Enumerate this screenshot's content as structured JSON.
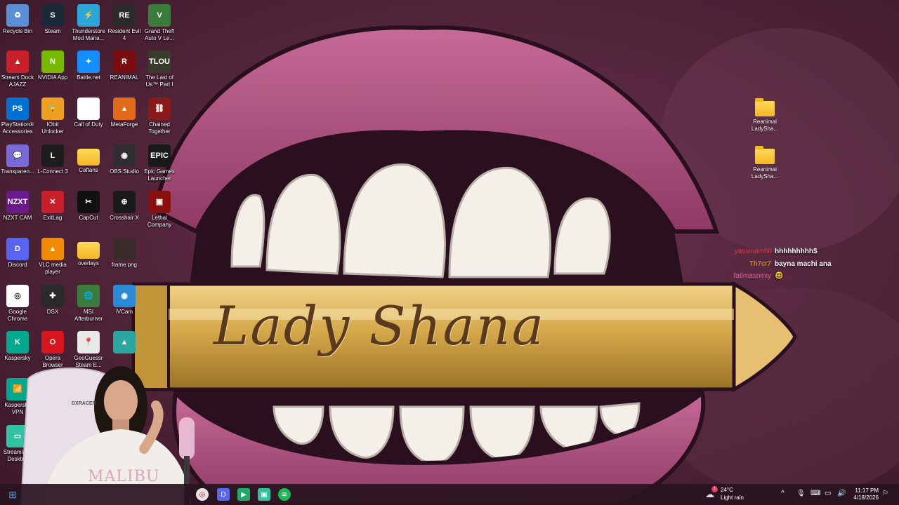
{
  "desktop_icons": [
    {
      "label": "Recycle Bin",
      "icon": "recycle-bin-icon",
      "color": "#5a8fd6",
      "glyph": "♻"
    },
    {
      "label": "Steam",
      "icon": "steam-icon",
      "color": "#1b2838",
      "glyph": "S"
    },
    {
      "label": "Thunderstore Mod Mana...",
      "icon": "thunderstore-icon",
      "color": "#2aa7d8",
      "glyph": "⚡"
    },
    {
      "label": "Resident Evil 4",
      "icon": "resident-evil-icon",
      "color": "#2b2b2b",
      "glyph": "RE"
    },
    {
      "label": "Grand Theft Auto V Le...",
      "icon": "gta-icon",
      "color": "#3a7d3a",
      "glyph": "V"
    },
    {
      "label": "Stream Dock AJAZZ",
      "icon": "stream-dock-icon",
      "color": "#c8202a",
      "glyph": "▲"
    },
    {
      "label": "NVIDIA App",
      "icon": "nvidia-icon",
      "color": "#76b900",
      "glyph": "N"
    },
    {
      "label": "Battle.net",
      "icon": "battlenet-icon",
      "color": "#148eff",
      "glyph": "✦"
    },
    {
      "label": "REANIMAL",
      "icon": "reanimal-icon",
      "color": "#7a0d10",
      "glyph": "R"
    },
    {
      "label": "The Last of Us™ Part I",
      "icon": "last-of-us-icon",
      "color": "#3b3b2b",
      "glyph": "TLOU"
    },
    {
      "label": "PlayStation® Accessories",
      "icon": "playstation-icon",
      "color": "#0070d1",
      "glyph": "PS"
    },
    {
      "label": "IObit Unlocker",
      "icon": "iobit-icon",
      "color": "#f0a020",
      "glyph": "🔒"
    },
    {
      "label": "Call of Duty",
      "icon": "call-of-duty-icon",
      "color": "#ffffff",
      "glyph": ""
    },
    {
      "label": "MetaForge",
      "icon": "metaforge-icon",
      "color": "#e06a1a",
      "glyph": "▲"
    },
    {
      "label": "Chained Together",
      "icon": "chained-together-icon",
      "color": "#8a1a1a",
      "glyph": "⛓"
    },
    {
      "label": "Transparen...",
      "icon": "transparent-icon",
      "color": "#7a6ad8",
      "glyph": "💬"
    },
    {
      "label": "L-Connect 3",
      "icon": "l-connect-icon",
      "color": "#1d1d1d",
      "glyph": "L"
    },
    {
      "label": "Caftans",
      "icon": "caftans-folder-icon",
      "color": "#f2b722",
      "glyph": ""
    },
    {
      "label": "OBS Studio",
      "icon": "obs-icon",
      "color": "#302e31",
      "glyph": "◉"
    },
    {
      "label": "Epic Games Launcher",
      "icon": "epic-games-icon",
      "color": "#1a1a1a",
      "glyph": "EPIC"
    },
    {
      "label": "NZXT CAM",
      "icon": "nzxt-icon",
      "color": "#6a1a8a",
      "glyph": "NZXT"
    },
    {
      "label": "ExitLag",
      "icon": "exitlag-icon",
      "color": "#c8202a",
      "glyph": "✕"
    },
    {
      "label": "CapCut",
      "icon": "capcut-icon",
      "color": "#111111",
      "glyph": "✂"
    },
    {
      "label": "Crosshair X",
      "icon": "crosshair-icon",
      "color": "#1a1a1a",
      "glyph": "⊕"
    },
    {
      "label": "Lethal Company",
      "icon": "lethal-company-icon",
      "color": "#8a1010",
      "glyph": "▣"
    },
    {
      "label": "Discord",
      "icon": "discord-icon",
      "color": "#5865f2",
      "glyph": "D"
    },
    {
      "label": "VLC media player",
      "icon": "vlc-icon",
      "color": "#f08a00",
      "glyph": "▲"
    },
    {
      "label": "overlays",
      "icon": "overlays-folder-icon",
      "color": "#f2b722",
      "glyph": ""
    },
    {
      "label": "frame.png",
      "icon": "frame-image-icon",
      "color": "#3a2a2a",
      "glyph": ""
    },
    {
      "label": "",
      "icon": "blank-icon",
      "color": "transparent",
      "glyph": ""
    },
    {
      "label": "Google Chrome",
      "icon": "chrome-icon",
      "color": "#ffffff",
      "glyph": "◎"
    },
    {
      "label": "DSX",
      "icon": "dsx-icon",
      "color": "#2a2a2a",
      "glyph": "✚"
    },
    {
      "label": "MSI Afterburner",
      "icon": "msi-afterburner-icon",
      "color": "#3a7d3a",
      "glyph": "🌐"
    },
    {
      "label": "iVCam",
      "icon": "ivcam-icon",
      "color": "#2a8ad8",
      "glyph": "◉"
    },
    {
      "label": "",
      "icon": "blank-icon",
      "color": "transparent",
      "glyph": ""
    },
    {
      "label": "Kaspersky",
      "icon": "kaspersky-icon",
      "color": "#00a88e",
      "glyph": "K"
    },
    {
      "label": "Opera Browser",
      "icon": "opera-icon",
      "color": "#d8141e",
      "glyph": "O"
    },
    {
      "label": "GeoGuessr Steam E...",
      "icon": "geoguessr-icon",
      "color": "#e8e8e8",
      "glyph": "📍"
    },
    {
      "label": "",
      "icon": "arc-icon",
      "color": "#2aa7a0",
      "glyph": "▲"
    },
    {
      "label": "",
      "icon": "blank-icon",
      "color": "transparent",
      "glyph": ""
    },
    {
      "label": "Kaspersky VPN",
      "icon": "kaspersky-vpn-icon",
      "color": "#00a88e",
      "glyph": "📶"
    },
    {
      "label": "",
      "icon": "blank-icon",
      "color": "transparent",
      "glyph": ""
    },
    {
      "label": "",
      "icon": "blank-icon",
      "color": "transparent",
      "glyph": ""
    },
    {
      "label": "",
      "icon": "blank-icon",
      "color": "transparent",
      "glyph": ""
    },
    {
      "label": "",
      "icon": "blank-icon",
      "color": "transparent",
      "glyph": ""
    },
    {
      "label": "Streamlabs Desktop",
      "icon": "streamlabs-icon",
      "color": "#31c3a2",
      "glyph": "▭"
    }
  ],
  "right_icons": [
    {
      "label": "Reanimal LadySha...",
      "icon": "folder-icon"
    },
    {
      "label": "Reanimal LadySha...",
      "icon": "folder-icon"
    }
  ],
  "wallpaper": {
    "logo_text": "Lady Shana",
    "lip_color": "#b45a84",
    "bullet_color": "#d4a84a",
    "mouth_color": "#2a0f1e",
    "background_color": "#5a2a40"
  },
  "chat": [
    {
      "user": "yassinamhil",
      "message": "hhhhhhhhh$",
      "color": "#d43a4a"
    },
    {
      "user": "Th7cr7",
      "message": "bayna machi ana",
      "color": "#e0a040"
    },
    {
      "user": "fatimasnexy",
      "message": "🤓",
      "color": "#e85aa8"
    }
  ],
  "webcam": {
    "shirt_text": "MALIBU",
    "chair_brand": "DXRACER"
  },
  "taskbar": {
    "apps": [
      {
        "icon": "start-icon",
        "color": "#3aa0ff",
        "glyph": "⊞"
      },
      {
        "icon": "chrome-taskbar-icon",
        "color": "#e0e0e0",
        "glyph": "◎"
      },
      {
        "icon": "discord-taskbar-icon",
        "color": "#5865f2",
        "glyph": "D"
      },
      {
        "icon": "streamlabs-taskbar-icon",
        "color": "#1fa86a",
        "glyph": "▶"
      },
      {
        "icon": "app-taskbar-icon",
        "color": "#2fc29a",
        "glyph": "▣"
      },
      {
        "icon": "spotify-taskbar-icon",
        "color": "#1db954",
        "glyph": "≋"
      }
    ],
    "weather_temp": "24°C",
    "weather_desc": "Light rain",
    "weather_badge": "1",
    "time": "11:17 PM",
    "date": "4/18/2026"
  }
}
